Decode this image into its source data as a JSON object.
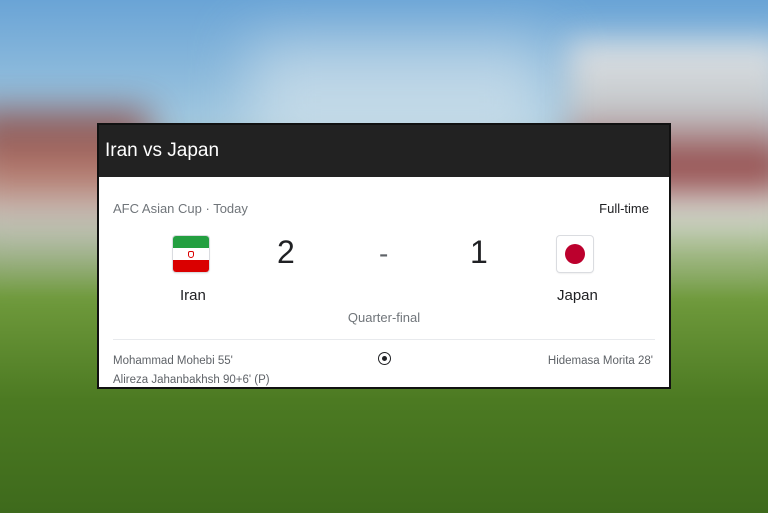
{
  "header": {
    "title": "Iran vs Japan"
  },
  "match": {
    "competition": "AFC Asian Cup · Today",
    "status": "Full-time",
    "stage": "Quarter-final",
    "separator": "-",
    "home": {
      "name": "Iran",
      "score": "2",
      "flag_icon": "iran-flag-icon",
      "scorers": [
        "Mohammad Mohebi 55'",
        "Alireza Jahanbakhsh 90+6' (P)"
      ]
    },
    "away": {
      "name": "Japan",
      "score": "1",
      "flag_icon": "japan-flag-icon",
      "scorers": [
        "Hidemasa Morita 28'"
      ]
    },
    "goal_icon": "soccer-ball-icon"
  },
  "colors": {
    "header_bg": "#222222",
    "iran_green": "#239f40",
    "iran_red": "#da0000",
    "japan_red": "#bc002d"
  }
}
